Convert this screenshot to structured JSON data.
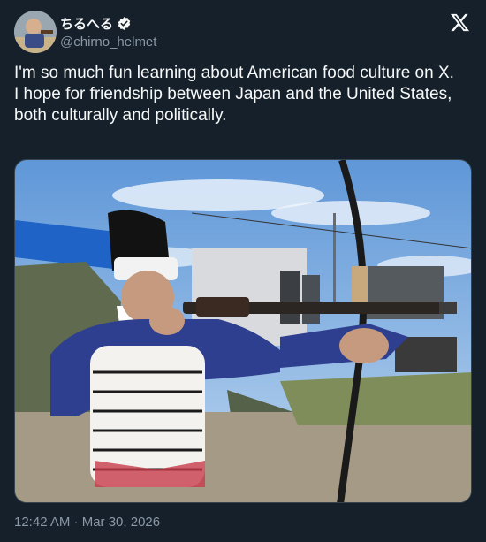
{
  "author": {
    "display_name": "ちるへる",
    "handle": "@chirno_helmet",
    "verified": true
  },
  "icons": {
    "verified": "verified-badge-icon",
    "brand": "x-logo-icon"
  },
  "tweet": {
    "lines": [
      "I'm so much fun learning about American food culture on X.",
      "I hope for friendship between Japan and the United States, both culturally and politically."
    ]
  },
  "meta": {
    "timestamp": "12:42 AM · Mar 30, 2026"
  },
  "colors": {
    "background": "#15202b",
    "text": "#f7f9f9",
    "secondary_text": "#8b98a5",
    "border": "#38444d"
  }
}
